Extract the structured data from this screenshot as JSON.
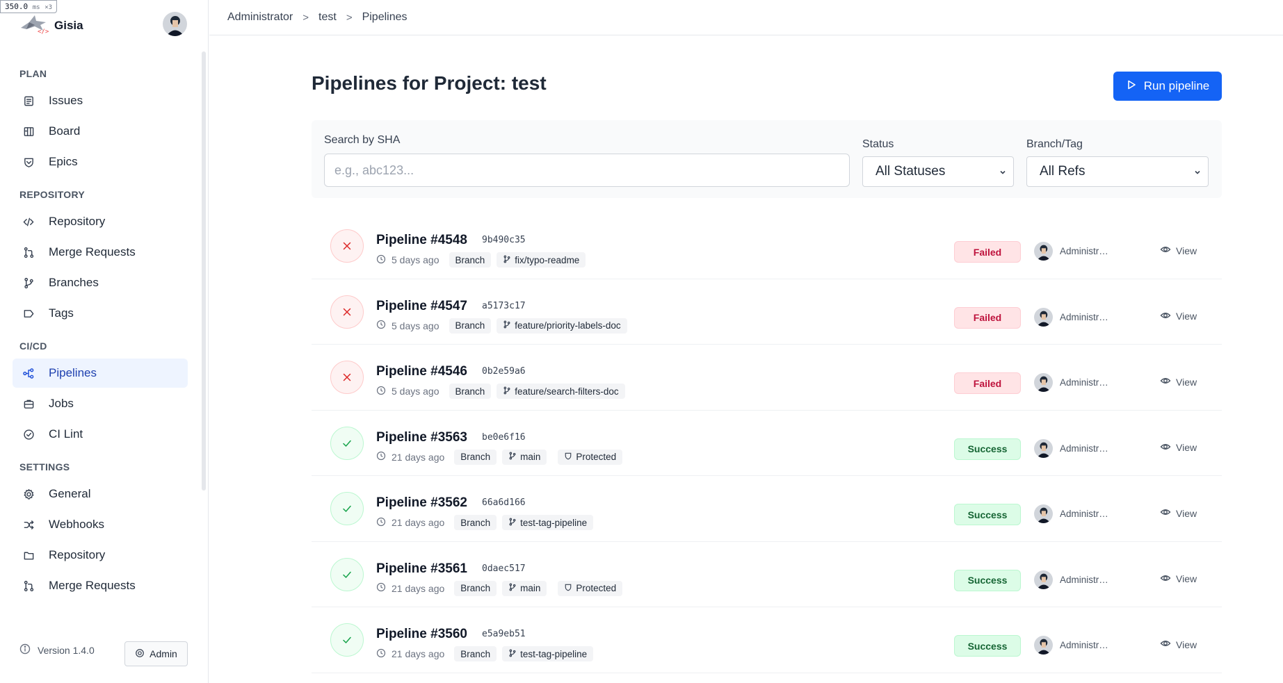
{
  "perf": {
    "value": "350.0",
    "unit": "ms",
    "mult": "×3"
  },
  "brand": {
    "name": "Gisia",
    "logo_icon": "shark-logo-icon"
  },
  "breadcrumb": [
    "Administrator",
    "test",
    "Pipelines"
  ],
  "breadcrumb_sep": ">",
  "sidebar": {
    "sections": [
      {
        "title": "PLAN",
        "items": [
          {
            "label": "Issues",
            "icon": "issues-icon"
          },
          {
            "label": "Board",
            "icon": "board-icon"
          },
          {
            "label": "Epics",
            "icon": "epics-icon"
          }
        ]
      },
      {
        "title": "REPOSITORY",
        "items": [
          {
            "label": "Repository",
            "icon": "code-icon"
          },
          {
            "label": "Merge Requests",
            "icon": "merge-request-icon"
          },
          {
            "label": "Branches",
            "icon": "branch-icon"
          },
          {
            "label": "Tags",
            "icon": "tag-icon"
          }
        ]
      },
      {
        "title": "CI/CD",
        "items": [
          {
            "label": "Pipelines",
            "icon": "pipeline-icon",
            "active": true
          },
          {
            "label": "Jobs",
            "icon": "jobs-icon"
          },
          {
            "label": "CI Lint",
            "icon": "check-circle-icon"
          }
        ]
      },
      {
        "title": "SETTINGS",
        "items": [
          {
            "label": "General",
            "icon": "gear-icon"
          },
          {
            "label": "Webhooks",
            "icon": "shuffle-icon"
          },
          {
            "label": "Repository",
            "icon": "folder-icon"
          },
          {
            "label": "Merge Requests",
            "icon": "merge-request-icon"
          }
        ]
      }
    ],
    "version": "Version 1.4.0",
    "admin_label": "Admin"
  },
  "page": {
    "title": "Pipelines for Project: test",
    "run_button": "Run pipeline"
  },
  "filters": {
    "search_label": "Search by SHA",
    "search_placeholder": "e.g., abc123...",
    "search_value": "",
    "status_label": "Status",
    "status_value": "All Statuses",
    "ref_label": "Branch/Tag",
    "ref_value": "All Refs"
  },
  "pipelines": [
    {
      "title": "Pipeline #4548",
      "sha": "9b490c35",
      "time": "5 days ago",
      "ref_type": "Branch",
      "ref": "fix/typo-readme",
      "protected": "",
      "status": "Failed",
      "status_kind": "failed",
      "user": "Administr…",
      "action": "View"
    },
    {
      "title": "Pipeline #4547",
      "sha": "a5173c17",
      "time": "5 days ago",
      "ref_type": "Branch",
      "ref": "feature/priority-labels-doc",
      "protected": "",
      "status": "Failed",
      "status_kind": "failed",
      "user": "Administr…",
      "action": "View"
    },
    {
      "title": "Pipeline #4546",
      "sha": "0b2e59a6",
      "time": "5 days ago",
      "ref_type": "Branch",
      "ref": "feature/search-filters-doc",
      "protected": "",
      "status": "Failed",
      "status_kind": "failed",
      "user": "Administr…",
      "action": "View"
    },
    {
      "title": "Pipeline #3563",
      "sha": "be0e6f16",
      "time": "21 days ago",
      "ref_type": "Branch",
      "ref": "main",
      "protected": "Protected",
      "status": "Success",
      "status_kind": "success",
      "user": "Administr…",
      "action": "View"
    },
    {
      "title": "Pipeline #3562",
      "sha": "66a6d166",
      "time": "21 days ago",
      "ref_type": "Branch",
      "ref": "test-tag-pipeline",
      "protected": "",
      "status": "Success",
      "status_kind": "success",
      "user": "Administr…",
      "action": "View"
    },
    {
      "title": "Pipeline #3561",
      "sha": "0daec517",
      "time": "21 days ago",
      "ref_type": "Branch",
      "ref": "main",
      "protected": "Protected",
      "status": "Success",
      "status_kind": "success",
      "user": "Administr…",
      "action": "View"
    },
    {
      "title": "Pipeline #3560",
      "sha": "e5a9eb51",
      "time": "21 days ago",
      "ref_type": "Branch",
      "ref": "test-tag-pipeline",
      "protected": "",
      "status": "Success",
      "status_kind": "success",
      "user": "Administr…",
      "action": "View"
    }
  ],
  "colors": {
    "accent": "#1463f5",
    "failed": "#be123c",
    "success": "#166534",
    "active_bg": "#eef4ff"
  }
}
